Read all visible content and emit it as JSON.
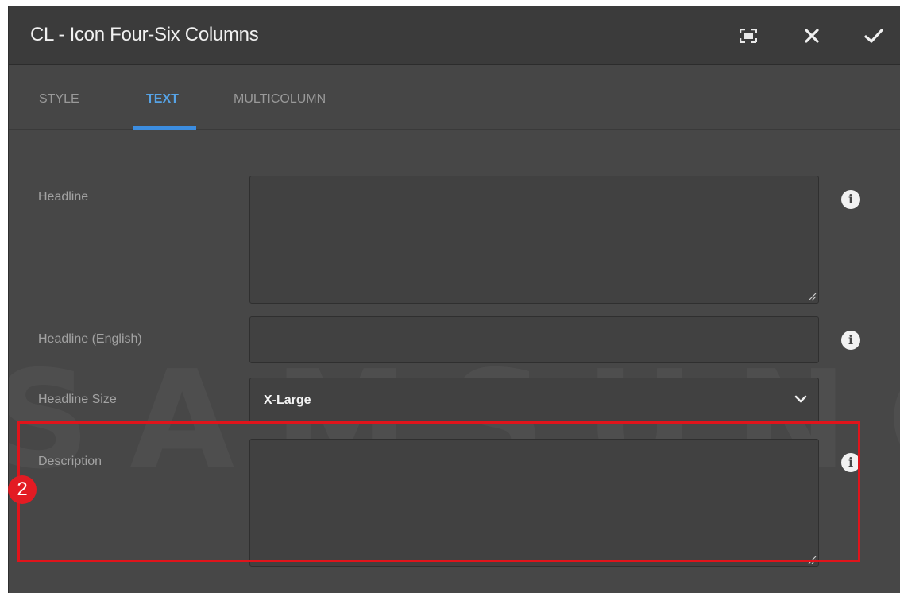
{
  "dialog": {
    "title": "CL - Icon Four-Six Columns",
    "buttons": {
      "fullscreen_icon": "fullscreen-icon",
      "close_icon": "close-icon",
      "done_icon": "checkmark-icon"
    }
  },
  "tabs": [
    {
      "label": "STYLE",
      "active": false
    },
    {
      "label": "TEXT",
      "active": true
    },
    {
      "label": "MULTICOLUMN",
      "active": false
    }
  ],
  "form": {
    "headline": {
      "label": "Headline",
      "value": ""
    },
    "headline_english": {
      "label": "Headline (English)",
      "value": ""
    },
    "headline_size": {
      "label": "Headline Size",
      "value": "X-Large"
    },
    "description": {
      "label": "Description",
      "value": ""
    }
  },
  "watermark": "SAMSUNG",
  "annotation": {
    "step_number": "2"
  },
  "colors": {
    "accent": "#3c8de0",
    "highlight": "#e0141b",
    "panel_bg": "#464646"
  }
}
